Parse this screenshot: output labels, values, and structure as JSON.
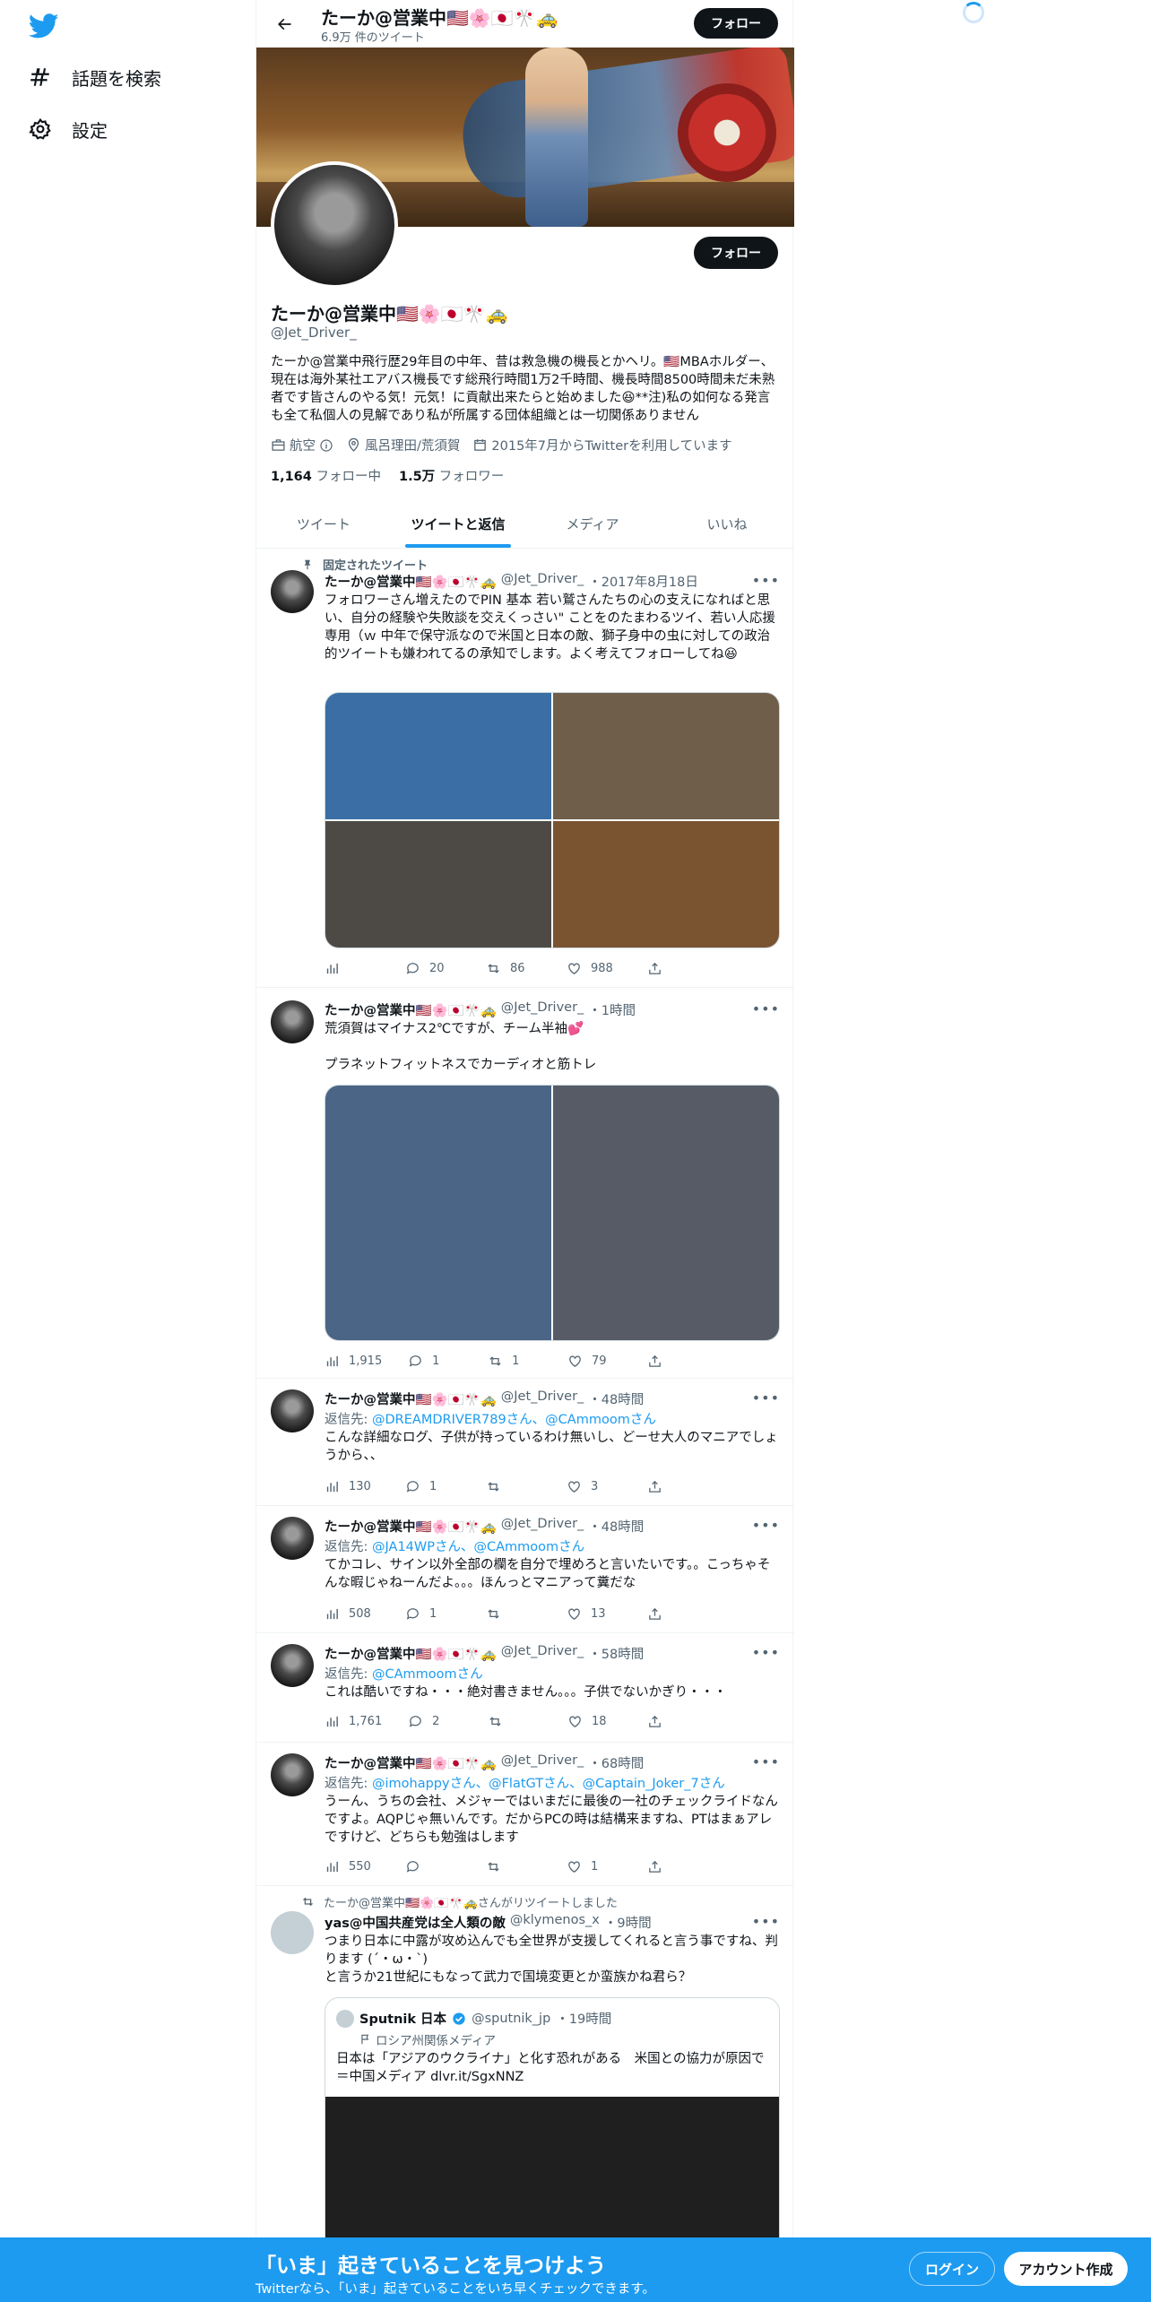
{
  "nav": {
    "explore_label": "話題を検索",
    "settings_label": "設定"
  },
  "header": {
    "name": "たーか@営業中🇺🇸🌸🇯🇵🎌🚕",
    "tweet_count": "6.9万 件のツイート",
    "follow_label": "フォロー"
  },
  "profile": {
    "name": "たーか@営業中🇺🇸🌸🇯🇵🎌🚕",
    "handle": "@Jet_Driver_",
    "bio": "たーか@営業中飛行歴29年目の中年、昔は救急機の機長とかヘリ。🇺🇸MBAホルダー、現在は海外某社エアバス機長です総飛行時間1万2千時間、機長時間8500時間未だ未熟者です皆さんのやる気！元気！に貢献出来たらと始めました😆**注)私の如何なる発言も全て私個人の見解であり私が所属する団体組織とは一切関係ありません",
    "category": "航空",
    "location": "風呂理田/荒須賀",
    "joined": "2015年7月からTwitterを利用しています",
    "following_count": "1,164",
    "following_label": "フォロー中",
    "followers_count": "1.5万",
    "followers_label": "フォロワー",
    "follow_label": "フォロー"
  },
  "tabs": [
    "ツイート",
    "ツイートと返信",
    "メディア",
    "いいね"
  ],
  "tweets": [
    {
      "pinned_label": "固定されたツイート",
      "name": "たーか@営業中🇺🇸🌸🇯🇵🎌🚕",
      "handle": "@Jet_Driver_",
      "time": "・2017年8月18日",
      "text": "フォロワーさん増えたのでPIN 基本 若い鷲さんたちの心の支えになればと思い、自分の経験や失敗談を交えくっさい\" ことをのたまわるツイ、若い人応援専用（ｗ 中年で保守派なので米国と日本の敵、獅子身中の虫に対しての政治的ツイートも嫌われてるの承知でします。よく考えてフォローしてね😆",
      "views": "",
      "replies": "20",
      "retweets": "86",
      "likes": "988"
    },
    {
      "name": "たーか@営業中🇺🇸🌸🇯🇵🎌🚕",
      "handle": "@Jet_Driver_",
      "time": "・1時間",
      "text": "荒須賀はマイナス2℃ですが、チーム半袖💕\n\nプラネットフィットネスでカーディオと筋トレ",
      "views": "1,915",
      "replies": "1",
      "retweets": "1",
      "likes": "79"
    },
    {
      "name": "たーか@営業中🇺🇸🌸🇯🇵🎌🚕",
      "handle": "@Jet_Driver_",
      "time": "・48時間",
      "reply_prefix": "返信先: ",
      "reply_to": "@DREAMDRIVER789さん、@CAmmoomさん",
      "text": "こんな詳細なログ、子供が持っているわけ無いし、どーせ大人のマニアでしょうから、、",
      "views": "130",
      "replies": "1",
      "retweets": "",
      "likes": "3"
    },
    {
      "name": "たーか@営業中🇺🇸🌸🇯🇵🎌🚕",
      "handle": "@Jet_Driver_",
      "time": "・48時間",
      "reply_prefix": "返信先: ",
      "reply_to": "@JA14WPさん、@CAmmoomさん",
      "text": "てかコレ、サイン以外全部の欄を自分で埋めろと言いたいです。。こっちゃそんな暇じゃねーんだよ。。。ほんっとマニアって糞だな",
      "views": "508",
      "replies": "1",
      "retweets": "",
      "likes": "13"
    },
    {
      "name": "たーか@営業中🇺🇸🌸🇯🇵🎌🚕",
      "handle": "@Jet_Driver_",
      "time": "・58時間",
      "reply_prefix": "返信先: ",
      "reply_to": "@CAmmoomさん",
      "text": "これは酷いですね・・・絶対書きません。。。子供でないかぎり・・・",
      "views": "1,761",
      "replies": "2",
      "retweets": "",
      "likes": "18"
    },
    {
      "name": "たーか@営業中🇺🇸🌸🇯🇵🎌🚕",
      "handle": "@Jet_Driver_",
      "time": "・68時間",
      "reply_prefix": "返信先: ",
      "reply_to": "@imohappyさん、@FlatGTさん、@Captain_Joker_7さん",
      "text": "うーん、うちの会社、メジャーではいまだに最後の一社のチェックライドなんですよ。AQPじゃ無いんです。だからPCの時は結構来ますね、PTはまぁアレですけど、どちらも勉強はします",
      "views": "550",
      "replies": "",
      "retweets": "",
      "likes": "1"
    },
    {
      "retweet_label": "たーか@営業中🇺🇸🌸🇯🇵🎌🚕さんがリツイートしました",
      "name": "yas@中国共産党は全人類の敵",
      "handle": "@klymenos_x",
      "time": "・9時間",
      "text": "つまり日本に中露が攻め込んでも全世界が支援してくれると言う事ですね、判ります (´・ω・`)\nと言うか21世紀にもなって武力で国境変更とか蛮族かね君ら？",
      "quote_name": "Sputnik 日本",
      "quote_handle": "@sputnik_jp",
      "quote_time": "・19時間",
      "quote_label": "ロシア州関係メディア",
      "quote_text": "日本は「アジアのウクライナ」と化す恐れがある　米国との協力が原因で＝中国メディア dlvr.it/SgxNNZ"
    }
  ],
  "bottom": {
    "title": "「いま」起きていることを見つけよう",
    "subtitle": "Twitterなら、「いま」起きていることをいち早くチェックできます。",
    "login": "ログイン",
    "signup": "アカウント作成"
  },
  "colors": {
    "accent": "#1d9bf0",
    "text": "#0f1419",
    "muted": "#536471"
  }
}
